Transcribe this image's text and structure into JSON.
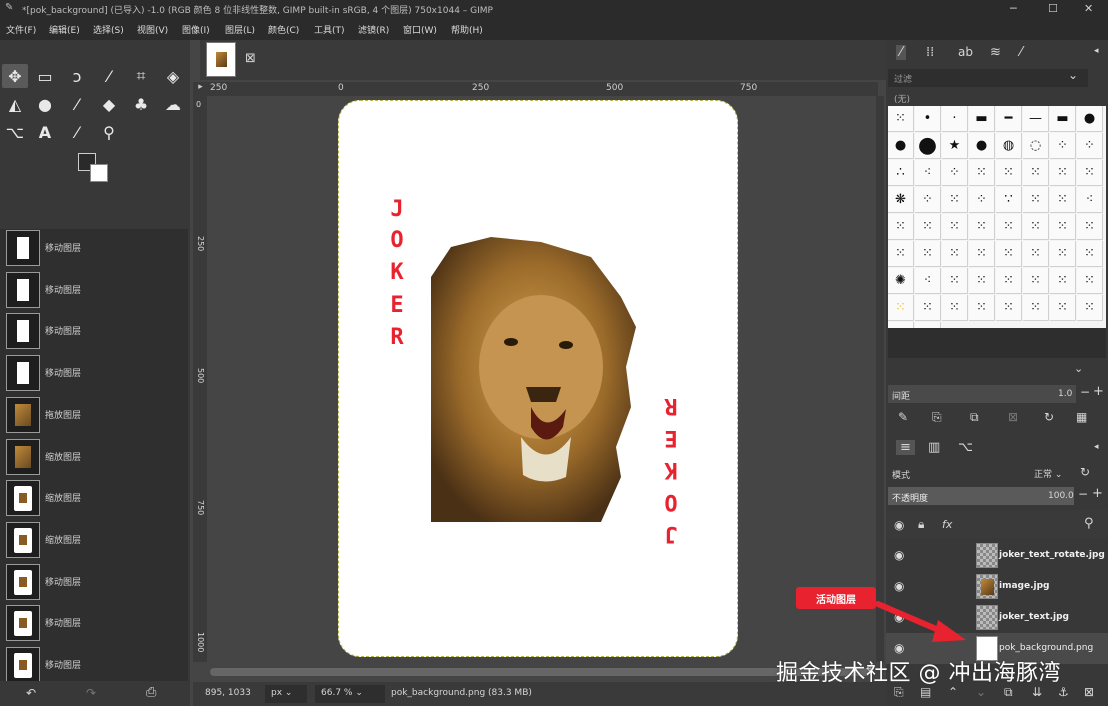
{
  "window": {
    "title": "*[pok_background] (已导入) -1.0 (RGB 颜色 8 位非线性整数, GIMP built-in sRGB, 4 个图层) 750x1044 – GIMP"
  },
  "menu": [
    "文件(F)",
    "编辑(E)",
    "选择(S)",
    "视图(V)",
    "图像(I)",
    "图层(L)",
    "颜色(C)",
    "工具(T)",
    "滤镜(R)",
    "窗口(W)",
    "帮助(H)"
  ],
  "history": [
    {
      "label": "移动图层",
      "thumb": "white"
    },
    {
      "label": "移动图层",
      "thumb": "white"
    },
    {
      "label": "移动图层",
      "thumb": "white"
    },
    {
      "label": "移动图层",
      "thumb": "white"
    },
    {
      "label": "拖放图层",
      "thumb": "lion"
    },
    {
      "label": "缩放图层",
      "thumb": "lion"
    },
    {
      "label": "缩放图层",
      "thumb": "card"
    },
    {
      "label": "缩放图层",
      "thumb": "card"
    },
    {
      "label": "移动图层",
      "thumb": "card"
    },
    {
      "label": "移动图层",
      "thumb": "card"
    },
    {
      "label": "移动图层",
      "thumb": "card"
    }
  ],
  "rulers": {
    "top": [
      "250",
      "0",
      "250",
      "500",
      "750"
    ],
    "left": [
      "0",
      "250",
      "500",
      "750",
      "1000"
    ]
  },
  "card": {
    "joker_top": [
      "J",
      "O",
      "K",
      "E",
      "R"
    ],
    "joker_bottom": [
      "R",
      "E",
      "K",
      "O",
      "J"
    ]
  },
  "status": {
    "coords": "895, 1033",
    "unit": "px",
    "zoom": "66.7 %",
    "file": "pok_background.png (83.3 MB)"
  },
  "brushes": {
    "filter_placeholder": "过滤",
    "tag": "(无)",
    "spacing_label": "间距",
    "spacing_value": "1.0"
  },
  "layers": {
    "mode_label": "模式",
    "mode_value": "正常",
    "opacity_label": "不透明度",
    "opacity_value": "100.0",
    "items": [
      {
        "name": "joker_text_rotate.jpg",
        "thumb": "checker"
      },
      {
        "name": "image.jpg",
        "thumb": "lion"
      },
      {
        "name": "joker_text.jpg",
        "thumb": "checker"
      },
      {
        "name": "pok_background.png",
        "thumb": "white"
      }
    ]
  },
  "annotation": "活动图层",
  "watermark": "掘金技术社区 @ 冲出海豚湾",
  "colors": {
    "accent_red": "#e8232f",
    "panel": "#383838",
    "canvas_bg": "#454545"
  }
}
